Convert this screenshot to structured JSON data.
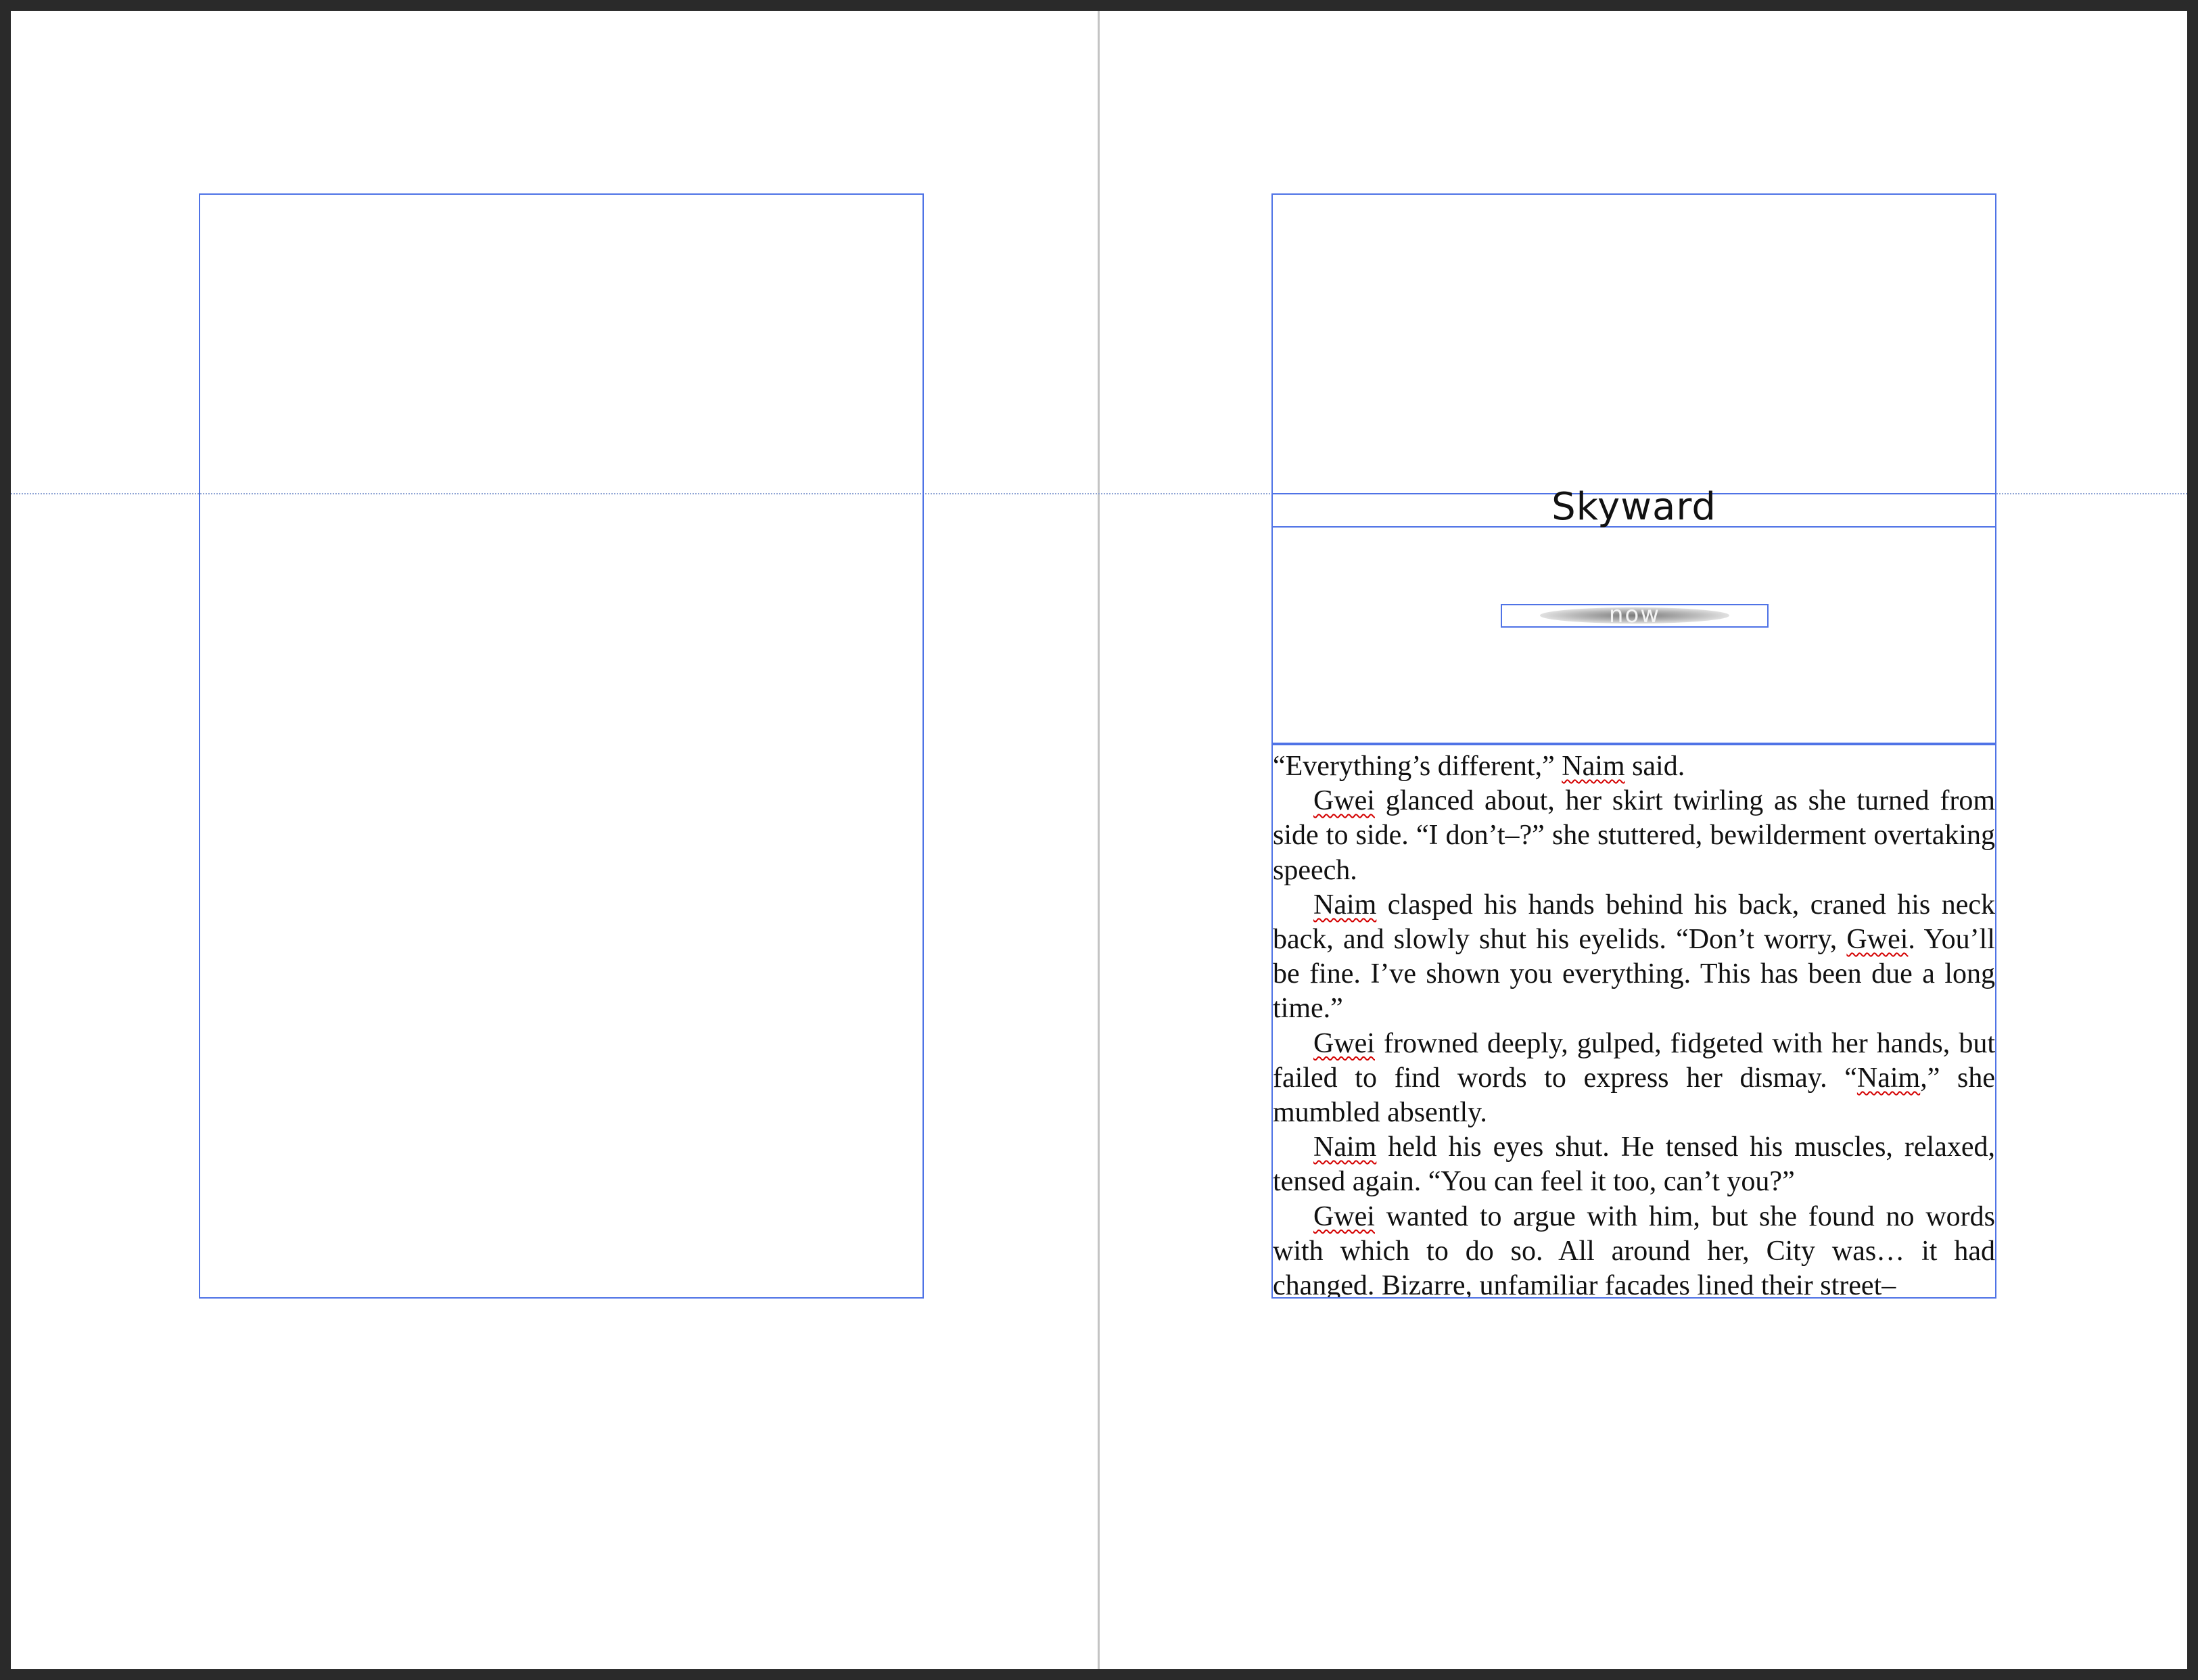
{
  "document": {
    "chapter_title": "Skyward",
    "ornament_text": "now",
    "paragraphs": [
      [
        {
          "t": "“Everything’s different,” "
        },
        {
          "t": "Naim",
          "sq": true
        },
        {
          "t": " said."
        }
      ],
      [
        {
          "t": "Gwei",
          "sq": true
        },
        {
          "t": " glanced about, her skirt twirling as she turned from side to side. “I don’t–?” she stuttered, bewilderment overtaking speech."
        }
      ],
      [
        {
          "t": "Naim",
          "sq": true
        },
        {
          "t": " clasped his hands behind his back, craned his neck back, and slowly shut his eyelids. “Don’t worry, "
        },
        {
          "t": "Gwei",
          "sq": true
        },
        {
          "t": ". You’ll be fine. I’ve shown you everything. This has been due a long time.”"
        }
      ],
      [
        {
          "t": "Gwei",
          "sq": true
        },
        {
          "t": " frowned deeply, gulped, fidgeted with her hands, but failed to find words to express her dismay. “"
        },
        {
          "t": "Naim",
          "sq": true
        },
        {
          "t": ",” she mumbled absently."
        }
      ],
      [
        {
          "t": "Naim",
          "sq": true
        },
        {
          "t": " held his eyes shut. He tensed his muscles, relaxed, tensed again. “You can feel it too, can’t you?”"
        }
      ],
      [
        {
          "t": "Gwei",
          "sq": true
        },
        {
          "t": " wanted to argue with him, but she found no words with which to do so. All around her, City was… it had changed. Bizarre, unfamiliar facades lined their street–"
        }
      ]
    ]
  },
  "colors": {
    "frame_border": "#4f73e6",
    "spelling_underline": "#d40000",
    "pasteboard": "#2a2a2a",
    "page": "#ffffff"
  }
}
